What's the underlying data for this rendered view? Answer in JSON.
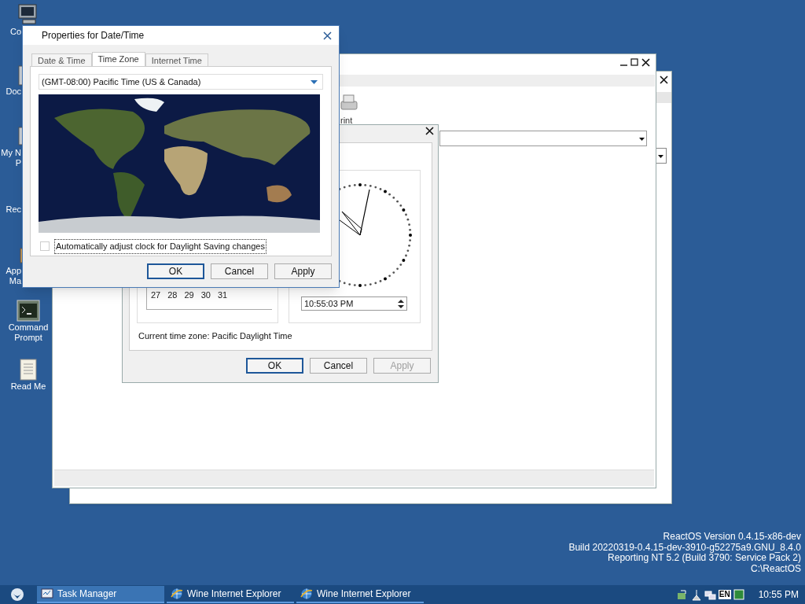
{
  "desktop_icons": [
    {
      "kind": "computer",
      "lines": [
        "Co"
      ]
    },
    {
      "kind": "documents",
      "lines": [
        "Doc"
      ]
    },
    {
      "kind": "network",
      "lines": [
        "My N",
        "P"
      ]
    },
    {
      "kind": "bin",
      "lines": [
        "Rec"
      ]
    },
    {
      "kind": "apps",
      "lines": [
        "App",
        "Ma"
      ]
    },
    {
      "kind": "console",
      "lines": [
        "Command",
        "Prompt"
      ]
    },
    {
      "kind": "text",
      "lines": [
        "Read Me"
      ]
    }
  ],
  "back_window": {
    "toolbar_label": "rint"
  },
  "datetime_window": {
    "calendar_days": [
      "27",
      "28",
      "29",
      "30",
      "31"
    ],
    "time_value": "10:55:03 PM",
    "current_zone": "Current time zone: Pacific Daylight Time",
    "buttons": [
      {
        "label": "OK",
        "default": true,
        "disabled": false
      },
      {
        "label": "Cancel",
        "default": false,
        "disabled": false
      },
      {
        "label": "Apply",
        "default": false,
        "disabled": true
      }
    ]
  },
  "dialog": {
    "title": "Properties for Date/Time",
    "tabs": [
      {
        "label": "Date & Time",
        "selected": false
      },
      {
        "label": "Time Zone",
        "selected": true
      },
      {
        "label": "Internet Time",
        "selected": false
      }
    ],
    "timezone": "(GMT-08:00) Pacific Time (US & Canada)",
    "daylight_checkbox": {
      "label": "Automatically adjust clock for Daylight Saving changes",
      "checked": false
    },
    "buttons": [
      {
        "label": "OK",
        "default": true,
        "disabled": false
      },
      {
        "label": "Cancel",
        "default": false,
        "disabled": false
      },
      {
        "label": "Apply",
        "default": false,
        "disabled": false
      }
    ]
  },
  "version_lines": [
    "ReactOS Version 0.4.15-x86-dev",
    "Build 20220319-0.4.15-dev-3910-g52275a9.GNU_8.4.0",
    "Reporting NT 5.2 (Build 3790: Service Pack 2)",
    "C:\\ReactOS"
  ],
  "taskbar": {
    "tasks": [
      {
        "kind": "taskmgr",
        "label": "Task Manager",
        "selected": true
      },
      {
        "kind": "browser",
        "label": "Wine Internet Explorer",
        "selected": false
      },
      {
        "kind": "browser",
        "label": "Wine Internet Explorer",
        "selected": false
      }
    ],
    "language": "EN",
    "clock": "10:55 PM"
  }
}
